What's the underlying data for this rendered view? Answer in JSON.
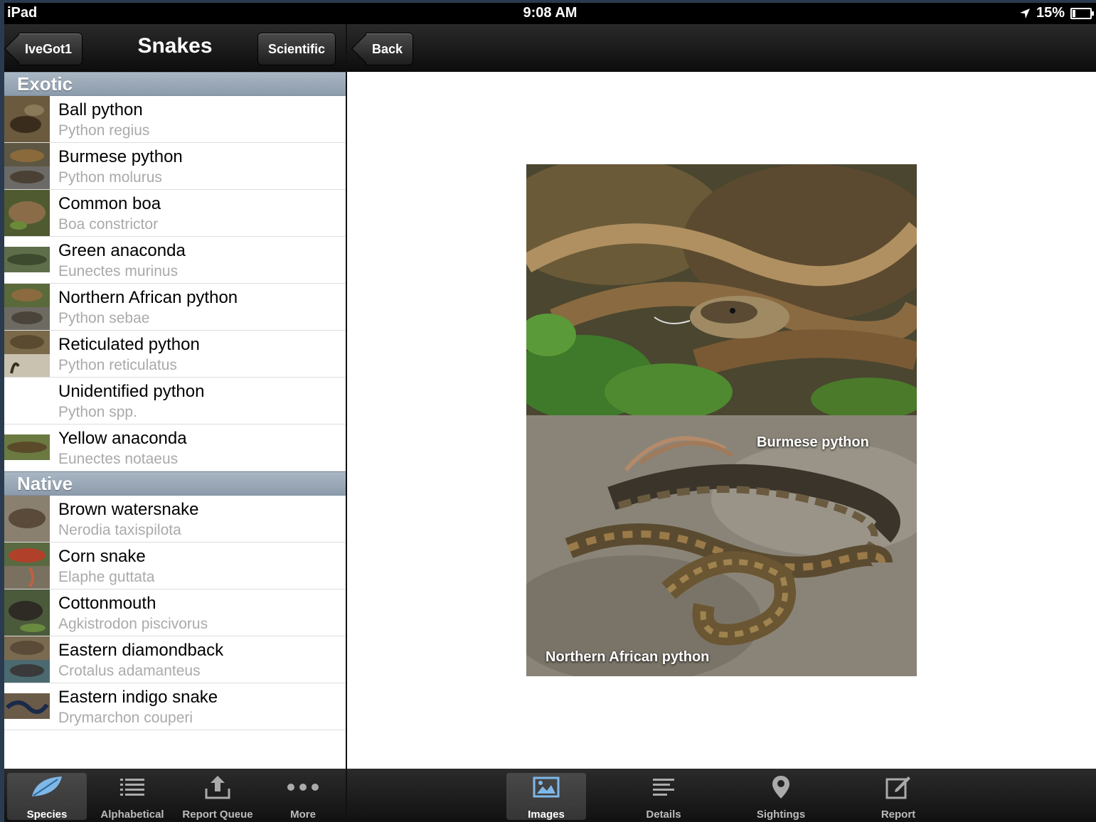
{
  "status_bar": {
    "carrier": "iPad",
    "time": "9:08 AM",
    "battery": "15%"
  },
  "left_nav": {
    "back_label": "IveGot1",
    "title": "Snakes",
    "toggle_label": "Scientific"
  },
  "right_nav": {
    "back_label": "Back"
  },
  "list": {
    "sections": [
      {
        "title": "Exotic",
        "items": [
          {
            "name": "Ball python",
            "scientific": "Python regius"
          },
          {
            "name": "Burmese python",
            "scientific": "Python molurus"
          },
          {
            "name": "Common boa",
            "scientific": "Boa constrictor"
          },
          {
            "name": "Green anaconda",
            "scientific": "Eunectes murinus"
          },
          {
            "name": "Northern African python",
            "scientific": "Python sebae"
          },
          {
            "name": "Reticulated python",
            "scientific": "Python reticulatus"
          },
          {
            "name": "Unidentified python",
            "scientific": "Python spp."
          },
          {
            "name": "Yellow anaconda",
            "scientific": "Eunectes notaeus"
          }
        ]
      },
      {
        "title": "Native",
        "items": [
          {
            "name": "Brown watersnake",
            "scientific": "Nerodia taxispilota"
          },
          {
            "name": "Corn snake",
            "scientific": "Elaphe guttata"
          },
          {
            "name": "Cottonmouth",
            "scientific": "Agkistrodon piscivorus"
          },
          {
            "name": "Eastern diamondback",
            "scientific": "Crotalus adamanteus"
          },
          {
            "name": "Eastern indigo snake",
            "scientific": "Drymarchon couperi"
          }
        ]
      }
    ]
  },
  "detail": {
    "caption_top": "Burmese python",
    "caption_bottom": "Northern African python"
  },
  "left_tabs": [
    {
      "label": "Species",
      "icon": "leaf-icon",
      "active": true
    },
    {
      "label": "Alphabetical",
      "icon": "list-icon",
      "active": false
    },
    {
      "label": "Report Queue",
      "icon": "upload-icon",
      "active": false
    },
    {
      "label": "More",
      "icon": "more-icon",
      "active": false
    }
  ],
  "right_tabs": [
    {
      "label": "Images",
      "icon": "image-icon",
      "active": true
    },
    {
      "label": "Details",
      "icon": "details-icon",
      "active": false
    },
    {
      "label": "Sightings",
      "icon": "pin-icon",
      "active": false
    },
    {
      "label": "Report",
      "icon": "compose-icon",
      "active": false
    }
  ]
}
